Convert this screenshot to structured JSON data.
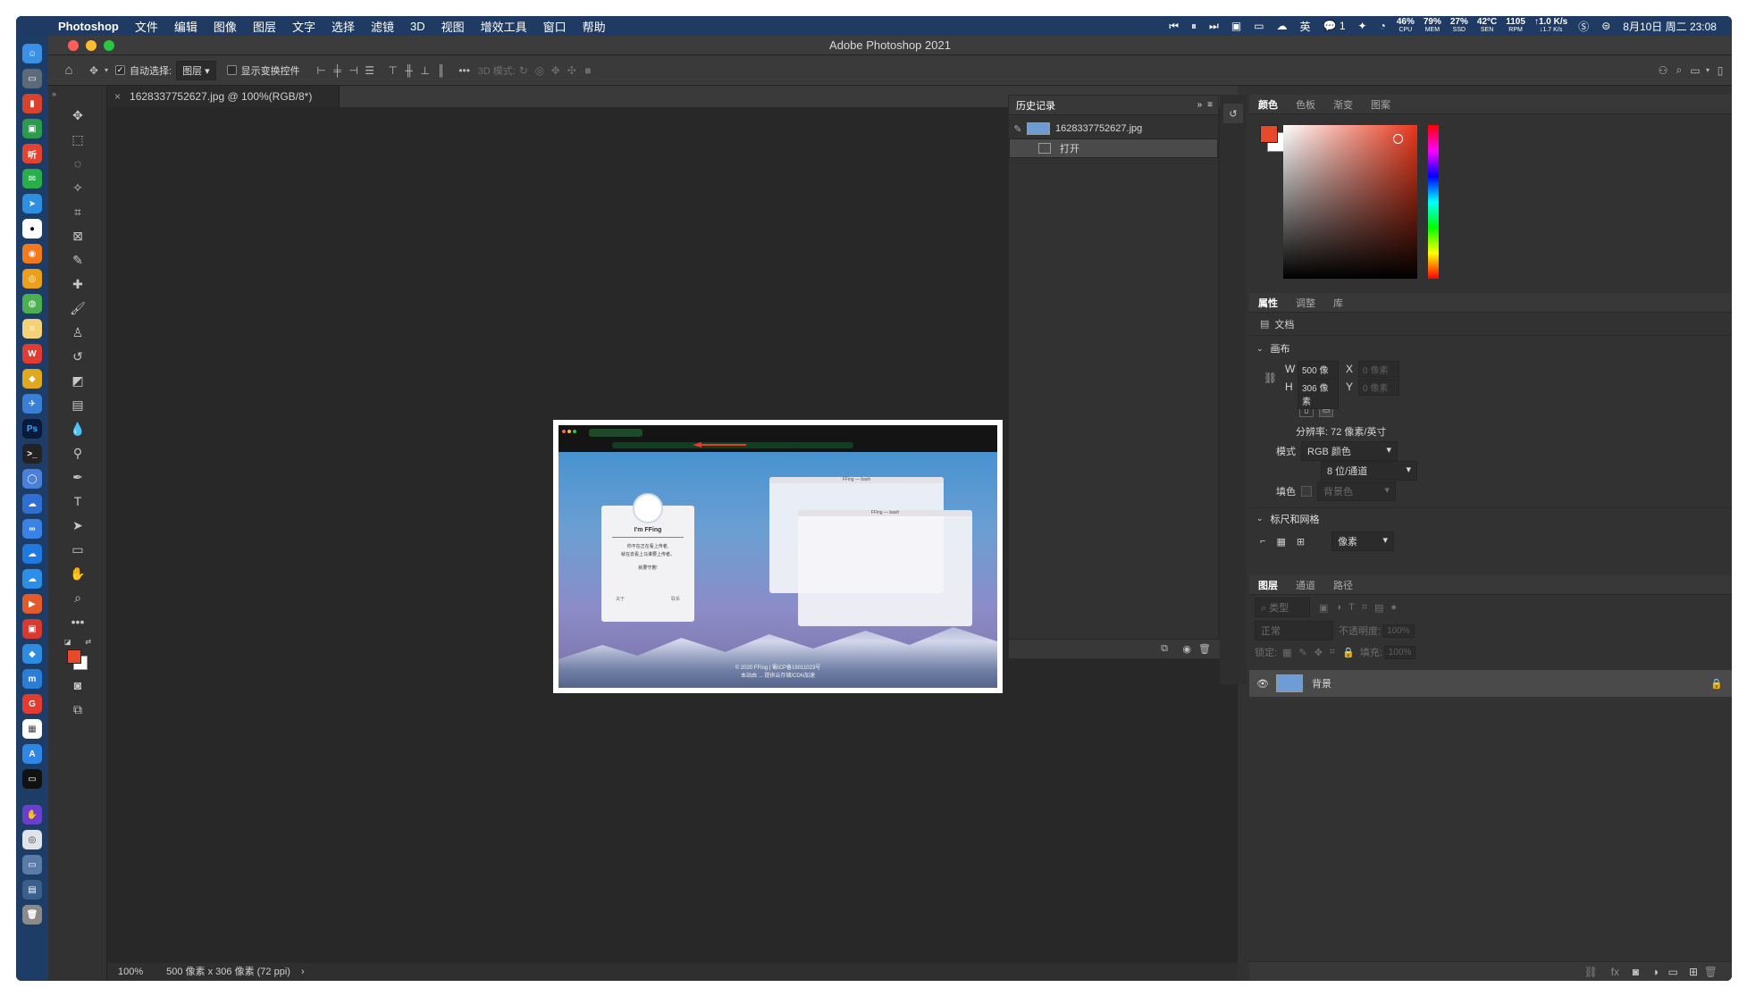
{
  "menubar": {
    "app_name": "Photoshop",
    "items": [
      "文件",
      "编辑",
      "图像",
      "图层",
      "文字",
      "选择",
      "滤镜",
      "3D",
      "视图",
      "增效工具",
      "窗口",
      "帮助"
    ],
    "input_method": "英",
    "wechat_count": "1",
    "stats": [
      {
        "value": "46%",
        "label": "CPU"
      },
      {
        "value": "79%",
        "label": "MEM"
      },
      {
        "value": "27%",
        "label": "SSD"
      },
      {
        "value": "42°C",
        "label": "SEN"
      },
      {
        "value": "1105",
        "label": "RPM"
      },
      {
        "value": "↑1.0 K/s",
        "label": "↓1.7 K/s"
      }
    ],
    "datetime": "8月10日 周二 23:08"
  },
  "window": {
    "title": "Adobe Photoshop 2021"
  },
  "options_bar": {
    "auto_select_label": "自动选择:",
    "auto_select_value": "图层",
    "show_transform_label": "显示变换控件",
    "mode_3d_label": "3D 模式:"
  },
  "document": {
    "tab_title": "1628337752627.jpg @ 100%(RGB/8*)",
    "zoom": "100%",
    "status_info": "500 像素 x 306 像素 (72 ppi)"
  },
  "history_panel": {
    "title": "历史记录",
    "snapshot_name": "1628337752627.jpg",
    "steps": [
      "打开"
    ]
  },
  "color_panel": {
    "tabs": [
      "颜色",
      "色板",
      "渐变",
      "图案"
    ],
    "foreground": "#e8492a",
    "background": "#ffffff"
  },
  "properties_panel": {
    "tabs": [
      "属性",
      "调整",
      "库"
    ],
    "doc_label": "文档",
    "canvas_section": "画布",
    "w_label": "W",
    "w_value": "500 像素",
    "h_label": "H",
    "h_value": "306 像素",
    "x_label": "X",
    "x_placeholder": "0 像素",
    "y_label": "Y",
    "y_placeholder": "0 像素",
    "resolution": "分辨率: 72 像素/英寸",
    "mode_label": "模式",
    "mode_value": "RGB 颜色",
    "depth_value": "8 位/通道",
    "fill_label": "填色",
    "fill_value": "背景色",
    "rulers_section": "标尺和网格",
    "units_value": "像素"
  },
  "layers_panel": {
    "tabs": [
      "图层",
      "通道",
      "路径"
    ],
    "kind_placeholder": "类型",
    "blend_mode": "正常",
    "opacity_label": "不透明度:",
    "opacity_value": "100%",
    "lock_label": "锁定:",
    "fill_label": "填充:",
    "fill_value": "100%",
    "layers": [
      {
        "name": "背景"
      }
    ]
  },
  "image_content": {
    "card_title": "I'm FFing",
    "card_line1": "你不在正在看上传者,",
    "card_line2": "就在去看上马谁要上传者。",
    "card_line3": "就要守着!",
    "card_btn_left": "关于",
    "card_btn_right": "联系",
    "term1_title": "FFing — bash",
    "term2_title": "FFing — bash",
    "caption_line1": "© 2020 FFing | 蜀ICP备19011023号",
    "caption_line2": "本站由 ... 提供云存储/CDN加速"
  }
}
